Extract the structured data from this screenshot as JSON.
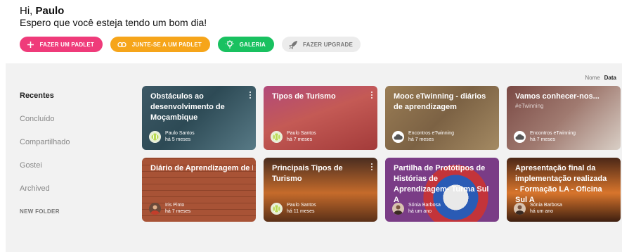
{
  "header": {
    "greeting_prefix": "Hi, ",
    "user_name": "Paulo",
    "subtitle": "Espero que você esteja tendo um bom dia!"
  },
  "actions": [
    {
      "label": "FAZER UM PADLET",
      "icon": "plus-icon",
      "color": "#ef3b7a"
    },
    {
      "label": "JUNTE-SE A UM PADLET",
      "icon": "link-icon",
      "color": "#f6a51a"
    },
    {
      "label": "GALERIA",
      "icon": "lightbulb-icon",
      "color": "#19c160"
    },
    {
      "label": "FAZER UPGRADE",
      "icon": "rocket-icon",
      "color": "#ececec"
    }
  ],
  "sort": {
    "name_label": "Nome",
    "date_label": "Data",
    "active": "Data"
  },
  "sidebar": {
    "items": [
      {
        "label": "Recentes",
        "active": true
      },
      {
        "label": "Concluído"
      },
      {
        "label": "Compartilhado"
      },
      {
        "label": "Gostei"
      },
      {
        "label": "Archived"
      }
    ],
    "new_folder": "NEW FOLDER"
  },
  "cards": [
    {
      "title": "Obstáculos ao desenvolvimento de Moçambique",
      "author": "Paulo Santos",
      "time": "há 5 meses",
      "avatar": "tennis-ball-icon"
    },
    {
      "title": "Tipos de Turismo",
      "author": "Paulo Santos",
      "time": "há 7 meses",
      "avatar": "tennis-ball-icon"
    },
    {
      "title": "Mooc eTwinning - diários de aprendizagem",
      "author": "Encontros eTwinning",
      "time": "há 7 meses",
      "avatar": "cloud-icon"
    },
    {
      "title": "Vamos conhecer-nos...",
      "tag": "#eTwinning",
      "author": "Encontros eTwinning",
      "time": "há 7 meses",
      "avatar": "cloud-icon"
    },
    {
      "title": "Diário de Aprendizagem de Iris Pinto",
      "author": "Iris Pinto",
      "time": "há 7 meses",
      "avatar": "person-photo-icon"
    },
    {
      "title": "Principais Tipos de Turismo",
      "author": "Paulo Santos",
      "time": "há 11 meses",
      "avatar": "tennis-ball-icon"
    },
    {
      "title": "Partilha de Protótipos de Histórias de Aprendizagem- Turma Sul A",
      "author": "Sónia Barbosa",
      "time": "há um ano",
      "avatar": "person-photo-icon"
    },
    {
      "title": "Apresentação final da implementação realizada - Formação LA - Oficina Sul A",
      "author": "Sónia Barbosa",
      "time": "há um ano",
      "avatar": "person-photo-icon"
    }
  ]
}
